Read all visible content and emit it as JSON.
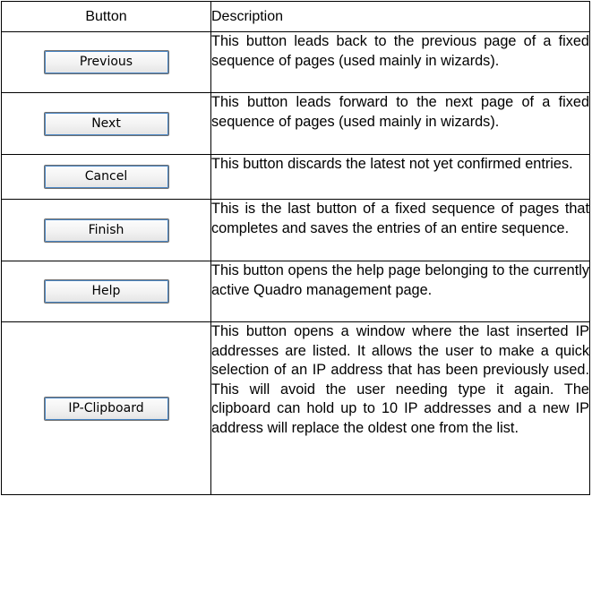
{
  "table": {
    "header": {
      "button": "Button",
      "description": "Description"
    },
    "rows": [
      {
        "button_label": "Previous",
        "description": "This button leads back to the previous page of a fixed sequence of pages (used mainly in wizards)."
      },
      {
        "button_label": "Next",
        "description": "This button leads forward to the next page of a fixed sequence of pages (used mainly in wizards)."
      },
      {
        "button_label": "Cancel",
        "description": "This button discards the latest not yet confirmed entries."
      },
      {
        "button_label": "Finish",
        "description": "This is the last button of a fixed sequence of pages that completes and saves the entries of an entire sequence."
      },
      {
        "button_label": "Help",
        "description": "This button opens the help page belonging to the currently active Quadro management page."
      },
      {
        "button_label": "IP-Clipboard",
        "description": "This button opens a window where the last inserted IP addresses are listed. It allows the user to make a quick selection of an IP address that has been previously used. This will avoid the user needing type it again. The clipboard can hold up to 10 IP addresses and a new IP address will replace the oldest one from the list."
      }
    ]
  }
}
